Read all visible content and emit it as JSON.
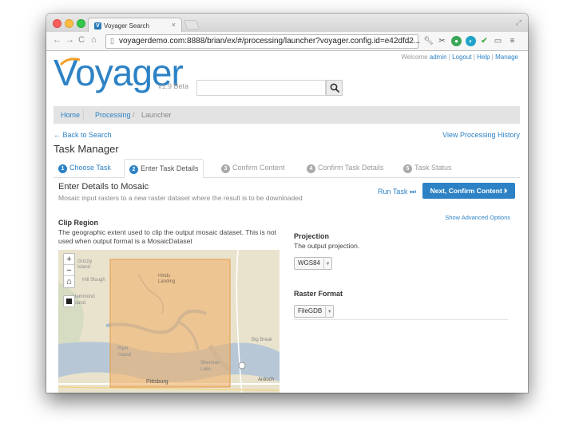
{
  "browser": {
    "tab_title": "Voyager Search",
    "tab_close": "×",
    "url": "voyagerdemo.com:8888/brian/ex/#/processing/launcher?voyager.config.id=e42dfd2...",
    "back": "←",
    "forward": "→",
    "reload": "C",
    "home": "⌂",
    "star": "☆"
  },
  "header": {
    "logo": "oyager",
    "logo_v": "V",
    "version": "v1.9 Beta",
    "search_placeholder": "",
    "welcome": "Welcome",
    "user": "admin",
    "logout": "Logout",
    "help": "Help",
    "manage": "Manage"
  },
  "breadcrumb": {
    "home": "Home",
    "processing": "Processing",
    "separator": "/",
    "launcher": "Launcher"
  },
  "links": {
    "back": "← Back to Search",
    "history": "View Processing History"
  },
  "task_manager_title": "Task Manager",
  "steps": [
    {
      "num": "1",
      "label": "Choose Task",
      "state": "done"
    },
    {
      "num": "2",
      "label": "Enter Task Details",
      "state": "active"
    },
    {
      "num": "3",
      "label": "Confirm Content",
      "state": "pending"
    },
    {
      "num": "4",
      "label": "Confirm Task Details",
      "state": "pending"
    },
    {
      "num": "5",
      "label": "Task Status",
      "state": "pending"
    }
  ],
  "details": {
    "title": "Enter Details to Mosaic",
    "description": "Mosaic input rasters to a new raster dataset where the result is to be downloaded",
    "run_task": "Run Task ⏭",
    "next_button": "Next, Confirm Content ⏵",
    "show_advanced": "Show Advanced Options"
  },
  "clip_region": {
    "title": "Clip Region",
    "description": "The geographic extent used to clip the output mosaic dataset. This is not used when output format is a MosaicDataset",
    "zoom_in": "+",
    "zoom_out": "−",
    "home": "⌂"
  },
  "projection": {
    "title": "Projection",
    "description": "The output projection.",
    "value": "WGS84"
  },
  "raster_format": {
    "title": "Raster Format",
    "value": "FileGDB"
  },
  "map_labels": [
    "Grizzly Island",
    "Hill Slough",
    "Hinds Landing",
    "Hammond Island",
    "Ryer Island",
    "Sherman Lake",
    "Pittsburg",
    "Antioch",
    "Big Break"
  ],
  "colors": {
    "accent": "#2d82c5",
    "clip_fill": "#f0b06a"
  }
}
